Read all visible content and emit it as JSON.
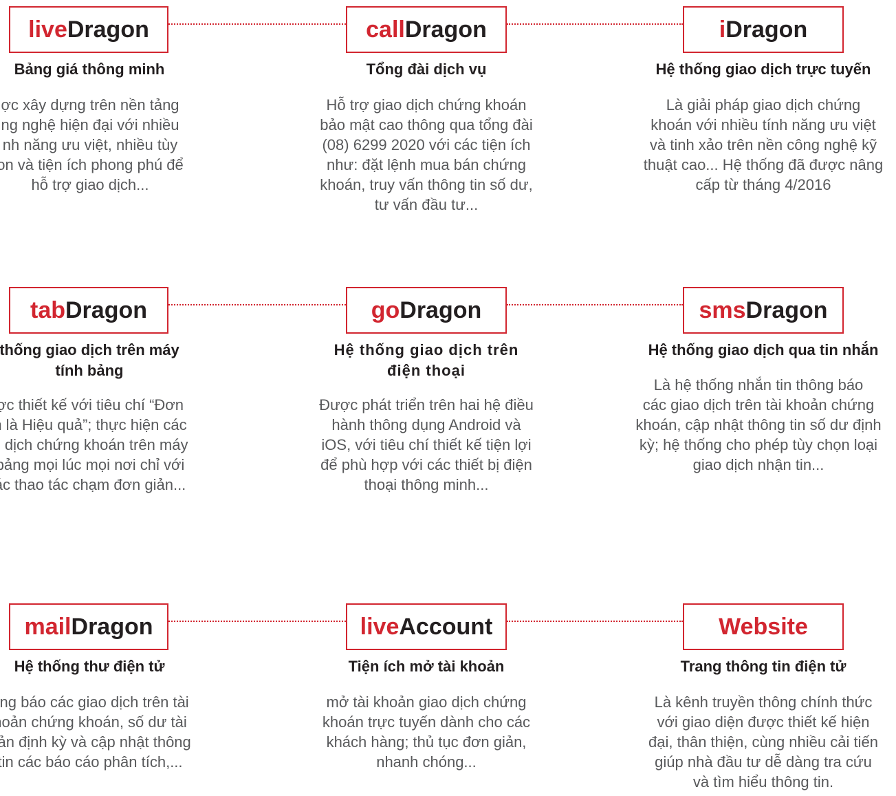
{
  "cards": [
    {
      "accent": "live",
      "name": "Dragon",
      "subtitle": "Bảng giá thông minh",
      "desc": "ợc xây dựng trên nền tảng\nng nghệ hiện đại với nhiều\nnh năng ưu việt, nhiều tùy\non và tiện ích phong phú để\nhỗ trợ giao dịch..."
    },
    {
      "accent": "call",
      "name": "Dragon",
      "subtitle": "Tổng đài dịch vụ",
      "desc": "Hỗ trợ giao dịch chứng khoán\nbảo mật cao thông qua tổng đài\n(08) 6299 2020 với các tiện ích\nnhư: đặt lệnh mua bán chứng\nkhoán, truy vấn thông tin số dư,\ntư vấn đầu tư..."
    },
    {
      "accent": "i",
      "name": "Dragon",
      "subtitle": "Hệ thống giao dịch trực tuyến",
      "desc": "Là giải pháp giao dịch chứng\nkhoán với nhiều tính năng ưu việt\nvà tinh xảo trên nền công nghệ kỹ\nthuật cao... Hệ thống đã được nâng\ncấp từ tháng 4/2016"
    },
    {
      "accent": "tab",
      "name": "Dragon",
      "subtitle": "thống giao dịch trên máy\ntính bảng",
      "desc": "ợc thiết kế với tiêu chí “Đơn\nn là Hiệu quả”; thực hiện các\no dịch chứng khoán trên máy\nbảng mọi lúc mọi nơi chỉ với\nác thao tác chạm đơn giản..."
    },
    {
      "accent": "go",
      "name": "Dragon",
      "subtitle": "Hệ thống giao dịch trên\nđiện thoại",
      "desc": "Được phát triển trên hai hệ điều\nhành thông dụng Android và\niOS, với tiêu chí thiết kế tiện lợi\nđể phù hợp với các thiết bị điện\nthoại thông minh..."
    },
    {
      "accent": "sms",
      "name": "Dragon",
      "subtitle": "Hệ thống giao dịch qua tin nhắn",
      "desc": "Là hệ thống nhắn tin thông báo\ncác giao dịch trên tài khoản chứng\nkhoán, cập nhật thông tin số dư định\nkỳ; hệ thống cho phép tùy chọn loại\ngiao dịch nhận tin..."
    },
    {
      "accent": "mail",
      "name": "Dragon",
      "subtitle": "Hệ thống thư điện tử",
      "desc": "ông báo các giao dịch trên tài\nhoản chứng khoán, số dư tài\noản định kỳ và cập nhật thông\ntin các báo cáo phân tích,..."
    },
    {
      "accent": "live",
      "name": "Account",
      "subtitle": "Tiện ích mở tài khoản",
      "desc": "mở tài khoản giao dịch chứng\nkhoán trực tuyến dành cho các\nkhách hàng; thủ tục đơn giản,\nnhanh chóng..."
    },
    {
      "accent": "Website",
      "name": "",
      "subtitle": "Trang thông tin điện tử",
      "desc": "Là kênh truyền thông chính thức\nvới giao diện được thiết kế hiện\nđại, thân thiện, cùng nhiều cải tiến\ngiúp nhà đầu tư dễ dàng tra cứu\nvà tìm hiểu thông tin."
    }
  ],
  "colors": {
    "accent": "#d22630",
    "heading": "#231f20",
    "body": "#58595b"
  }
}
